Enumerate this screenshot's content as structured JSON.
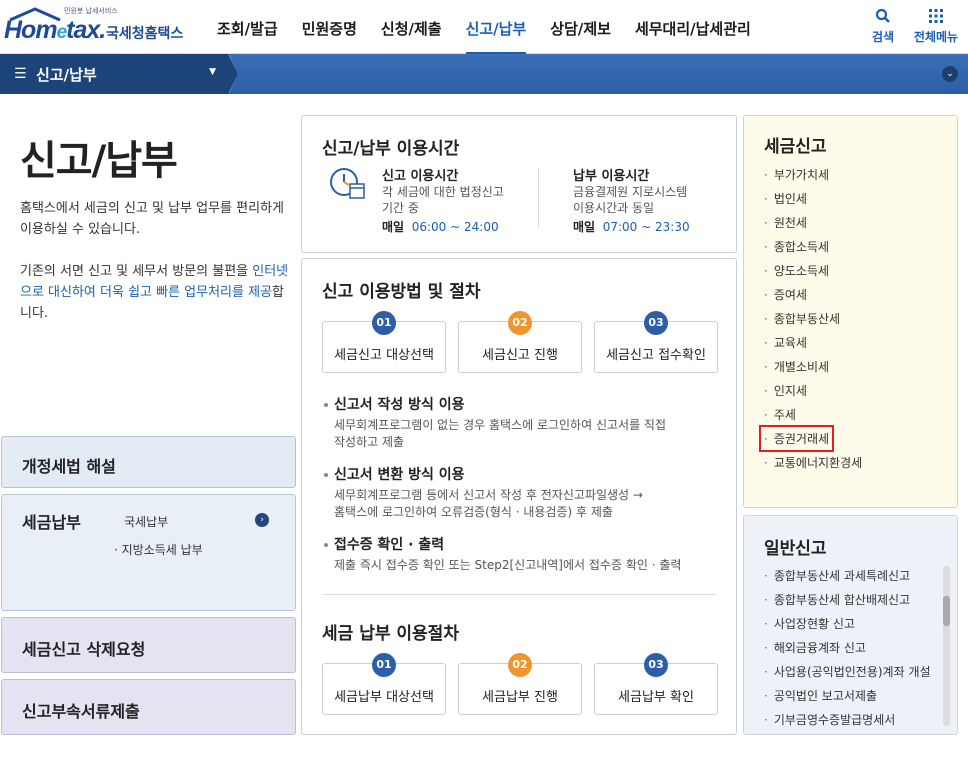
{
  "header": {
    "logo_tagline": "민원봇 납세서비스",
    "logo_mark_a": "Hom",
    "logo_mark_e": "e",
    "logo_mark_b": "tax.",
    "logo_ko": "국세청홈택스",
    "nav": [
      "조회/발급",
      "민원증명",
      "신청/제출",
      "신고/납부",
      "상담/제보",
      "세무대리/납세관리"
    ],
    "active_nav": 3,
    "search_label": "검색",
    "allmenu_label": "전체메뉴"
  },
  "locbar": {
    "menu_label": "신고/납부"
  },
  "left": {
    "page_title": "신고/납부",
    "desc1": "홈택스에서 세금의 신고 및 납부 업무를 편리하게 이용하실 수 있습니다.",
    "desc2_pre": "기존의 서면 신고 및 세무서 방문의 불편을",
    "desc2_hl": "인터넷으로 대신하여 더욱 쉽고 빠른 업무처리를 제공",
    "desc2_post": "합니다.",
    "box1": "개정세법 해설",
    "box2": "세금납부",
    "box2_sub1": "국세납부",
    "box2_sub2": "· 지방소득세 납부",
    "box3": "세금신고 삭제요청",
    "box4": "신고부속서류제출"
  },
  "usage": {
    "title": "신고/납부 이용시간",
    "report_title": "신고 이용시간",
    "report_desc": [
      "각 세금에 대한 법정신고",
      "기간 중"
    ],
    "report_time_label": "매일",
    "report_time": "06:00 ~ 24:00",
    "pay_title": "납부 이용시간",
    "pay_desc": [
      "금융결제원 지로시스템",
      "이용시간과 동일"
    ],
    "pay_time_label": "매일",
    "pay_time": "07:00 ~ 23:30"
  },
  "procedure": {
    "title": "신고 이용방법 및 절차",
    "steps": [
      {
        "num": "01",
        "label": "세금신고 대상선택"
      },
      {
        "num": "02",
        "label": "세금신고 진행"
      },
      {
        "num": "03",
        "label": "세금신고 접수확인"
      }
    ],
    "methods": [
      {
        "title": "신고서 작성 방식 이용",
        "desc": [
          "세무회계프로그램이 없는 경우 홈택스에 로그인하여 신고서를 직접",
          "작성하고 제출"
        ]
      },
      {
        "title": "신고서 변환 방식 이용",
        "desc": [
          "세무회계프로그램 등에서 신고서 작성 후 전자신고파일생성 →",
          "홈택스에 로그인하여 오류검증(형식 · 내용검증) 후 제출"
        ]
      },
      {
        "title": "접수증 확인 · 출력",
        "desc": [
          "제출 즉시 접수증 확인 또는 Step2[신고내역]에서 접수증 확인 · 출력"
        ]
      }
    ],
    "pay_title": "세금 납부 이용절차",
    "pay_steps": [
      {
        "num": "01",
        "label": "세금납부 대상선택"
      },
      {
        "num": "02",
        "label": "세금납부 진행"
      },
      {
        "num": "03",
        "label": "세금납부 확인"
      }
    ]
  },
  "tax_report": {
    "title": "세금신고",
    "items": [
      "부가가치세",
      "법인세",
      "원천세",
      "종합소득세",
      "양도소득세",
      "증여세",
      "종합부동산세",
      "교육세",
      "개별소비세",
      "인지세",
      "주세",
      "증권거래세",
      "교통에너지환경세"
    ],
    "highlighted_index": 11
  },
  "general_report": {
    "title": "일반신고",
    "items": [
      "종합부동산세 과세특례신고",
      "종합부동산세 합산배제신고",
      "사업장현황 신고",
      "해외금융계좌 신고",
      "사업용(공익법인전용)계좌 개설",
      "공익법인 보고서제출",
      "기부금영수증발급명세서"
    ]
  },
  "colors": {
    "primary": "#1a5fb4",
    "navy": "#1d4479",
    "orange": "#f0942d",
    "highlight": "#e21f1f"
  }
}
